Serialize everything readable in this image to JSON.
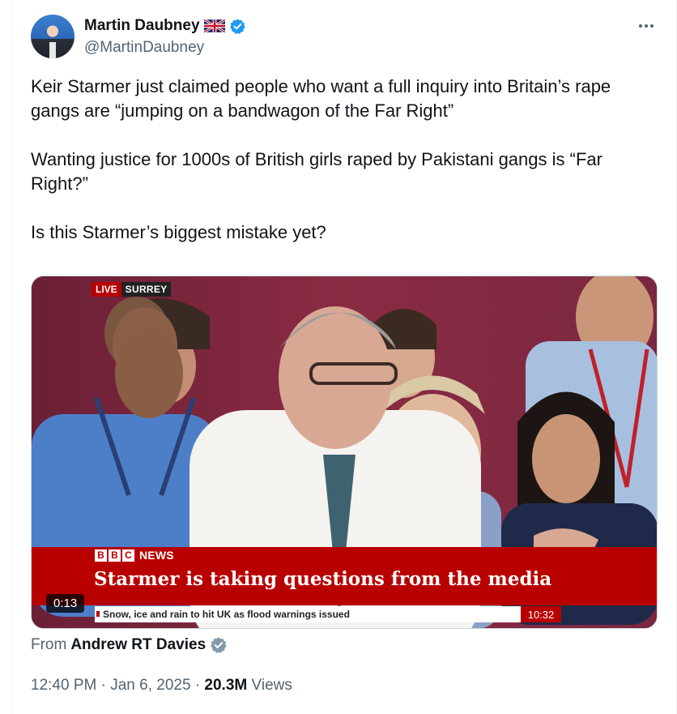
{
  "author": {
    "name": "Martin Daubney",
    "handle": "@MartinDaubney"
  },
  "post": {
    "paragraphs": [
      "Keir Starmer just claimed people who want a full inquiry into Britain’s rape gangs are “jumping on a bandwagon of the Far Right”",
      "Wanting justice for 1000s of British girls raped by Pakistani gangs is “Far Right?”",
      "Is this Starmer’s biggest mistake yet?"
    ]
  },
  "video": {
    "live_label": "LIVE",
    "location_label": "SURREY",
    "broadcaster_letters": [
      "B",
      "B",
      "C"
    ],
    "broadcaster_news": "NEWS",
    "headline": "Starmer is taking questions from the media",
    "ticker": "Snow, ice and rain to hit UK as flood warnings issued",
    "clock": "10:32",
    "duration": "0:13"
  },
  "source": {
    "prefix": "From",
    "name": "Andrew RT Davies"
  },
  "meta": {
    "time": "12:40 PM",
    "sep1": "·",
    "date": "Jan 6, 2025",
    "sep2": "·",
    "views_count": "20.3M",
    "views_label": "Views"
  },
  "colors": {
    "verified_blue": "#1d9bf0",
    "verified_gray": "#829aab",
    "bbc_red": "#b80000",
    "text_secondary": "#536471"
  },
  "icons": [
    "uk-flag-icon",
    "verified-badge-icon",
    "more-options-icon",
    "gray-verified-badge-icon"
  ]
}
